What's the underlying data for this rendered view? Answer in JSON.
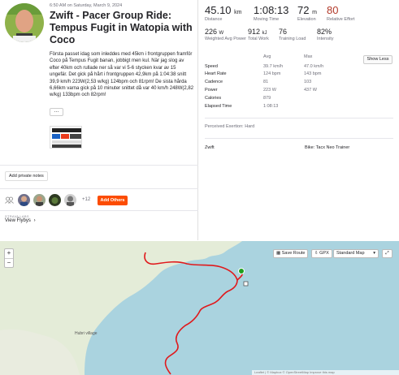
{
  "activity": {
    "date": "6:50 AM on Saturday, March 9, 2024",
    "title": "Zwift - Pacer Group Ride: Tempus Fugit in Watopia with Coco",
    "description": "Första passet idag som inleddes med 45km i frontgruppen framför Coco på Tempus Fugit banan, jobbigt men kul. När jag slog av efter 40km och rullade ner så var vi 5-6 stycken kvar av 15 ungefär. Det gick på hårt i frontgruppen 42,9km på 1:04:38 snitt 39,9 km/h 223W(2,53 w/kg) 124bpm och 81rpm! De sista hårda 6,66km varna gick på 10 minuter snittet då var 40 km/h 248W(2,82 w/kg) 133bpm och 82rpm!",
    "more_label": "...",
    "add_private_notes": "Add private notes",
    "plus_count": "+12",
    "add_others": "Add Others",
    "strava_labs": "STRAVA LABS",
    "flybys": "View Flybys"
  },
  "stats": {
    "distance": {
      "value": "45.10",
      "unit": "km",
      "label": "Distance"
    },
    "moving_time": {
      "value": "1:08:13",
      "label": "Moving Time"
    },
    "elevation": {
      "value": "72",
      "unit": "m",
      "label": "Elevation"
    },
    "relative_effort": {
      "value": "80",
      "label": "Relative Effort"
    },
    "weighted_power": {
      "value": "226",
      "unit": "W",
      "label": "Weighted Avg Power"
    },
    "total_work": {
      "value": "912",
      "unit": "kJ",
      "label": "Total Work"
    },
    "training_load": {
      "value": "76",
      "label": "Training Load"
    },
    "intensity": {
      "value": "82%",
      "label": "Intensity"
    }
  },
  "show_less": "Show Less",
  "table": {
    "col_avg": "Avg",
    "col_max": "Max",
    "rows": [
      {
        "label": "Speed",
        "avg": "39.7 km/h",
        "max": "47.0 km/h"
      },
      {
        "label": "Heart Rate",
        "avg": "124 bpm",
        "max": "143 bpm"
      },
      {
        "label": "Cadence",
        "avg": "81",
        "max": "103"
      },
      {
        "label": "Power",
        "avg": "223 W",
        "max": "437 W"
      },
      {
        "label": "Calories",
        "avg": "879",
        "max": ""
      },
      {
        "label": "Elapsed Time",
        "avg": "1:08:13",
        "max": ""
      }
    ]
  },
  "perceived_exertion": "Perceived Exertion: Hard",
  "device": {
    "app": "Zwift",
    "bike": "Bike: Tacx Neo Trainer"
  },
  "map": {
    "zoom_in": "+",
    "zoom_out": "−",
    "save_route": "Save Route",
    "gpx": "GPX",
    "map_type": "Standard Map",
    "place": "Hubri village",
    "attribution": "Leaflet | © Mapbox © OpenStreetMap Improve this map",
    "colors": {
      "water": "#aad3df",
      "land": "#e4ecd8",
      "route": "#e0191c",
      "start": "#1fa01f"
    }
  }
}
